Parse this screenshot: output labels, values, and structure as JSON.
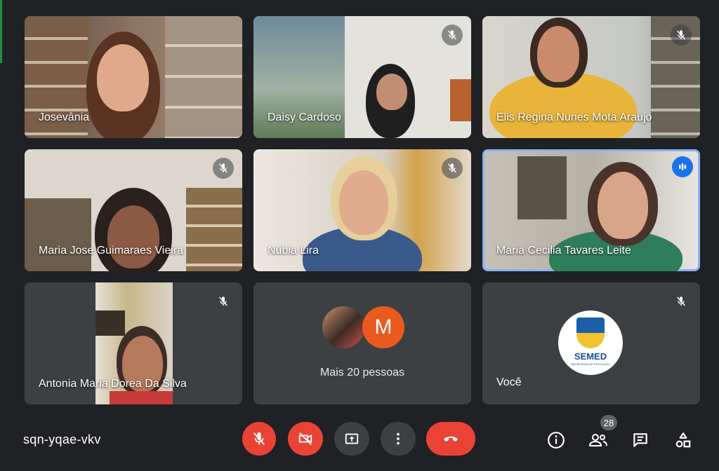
{
  "participants": [
    {
      "name": "Josevânia",
      "muted": false
    },
    {
      "name": "Daisy Cardoso",
      "muted": true
    },
    {
      "name": "Elis Regina Nunes Mota Araujo",
      "muted": true
    },
    {
      "name": "Maria Jose Guimaraes Vieira",
      "muted": true
    },
    {
      "name": "Núbia Lira",
      "muted": true
    },
    {
      "name": "Maria Cecilia Tavares Leite",
      "muted": false,
      "speaking": true
    },
    {
      "name": "Antonia Maria Dorea Da Silva",
      "muted": true
    }
  ],
  "others": {
    "label": "Mais 20 pessoas",
    "avatar_letter": "M"
  },
  "self": {
    "label": "Você",
    "logo_text": "SEMED",
    "logo_sub": "SECRETARIA DE EDUCAÇÃO",
    "muted": true
  },
  "meeting_code": "sqn-yqae-vkv",
  "participant_count": "28",
  "colors": {
    "danger": "#ea4335",
    "speaking": "#1a73e8",
    "background": "#202124",
    "tile": "#3c4043"
  }
}
